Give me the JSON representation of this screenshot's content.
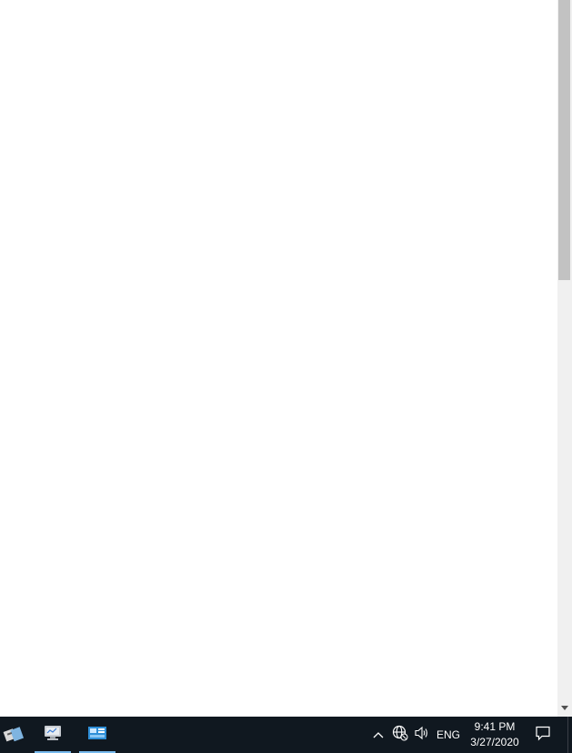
{
  "taskbar": {
    "language": "ENG",
    "clock": {
      "time": "9:41 PM",
      "date": "3/27/2020"
    },
    "apps": [
      {
        "icon": "server-manager-icon"
      },
      {
        "icon": "computer-management-icon"
      },
      {
        "icon": "control-panel-icon"
      }
    ],
    "tray_icons": [
      "chevron-up-icon",
      "network-icon",
      "volume-icon",
      "notification-icon"
    ]
  },
  "colors": {
    "taskbar_bg": "#101820",
    "active_underline": "#76b9ed",
    "scrollbar_thumb": "#c2c2c2"
  }
}
